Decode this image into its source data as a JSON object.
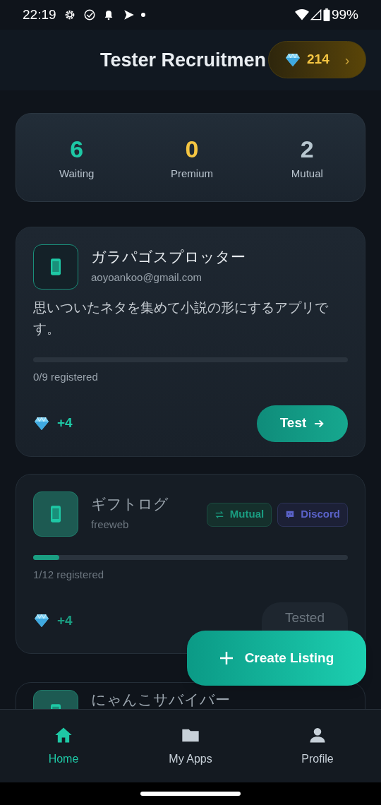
{
  "status_bar": {
    "time": "22:19",
    "battery": "99%"
  },
  "header": {
    "title": "Tester Recruitmen",
    "gems": "214",
    "chevron": "›"
  },
  "stats": [
    {
      "value": "6",
      "label": "Waiting",
      "color": "#1ec8a5"
    },
    {
      "value": "0",
      "label": "Premium",
      "color": "#f4c542"
    },
    {
      "value": "2",
      "label": "Mutual",
      "color": "#b8c7d0"
    }
  ],
  "listings": [
    {
      "name": "ガラパゴスプロッター",
      "developer": "aoyoankoo@gmail.com",
      "description": "思いついたネタを集めて小説の形にするアプリです。",
      "level": 0,
      "progress": "0/9 registered",
      "reward": "+4",
      "action": {
        "kind": "test",
        "label": "Test"
      }
    },
    {
      "name": "ギフトログ",
      "developer": "freeweb",
      "level": 0.083,
      "progress": "1/12 registered",
      "reward": "+4",
      "tags": [
        {
          "kind": "mutual",
          "label": "Mutual"
        },
        {
          "kind": "discord",
          "label": "Discord"
        }
      ],
      "action": {
        "kind": "tested",
        "label": "Tested"
      }
    },
    {
      "name": "にゃんこサバイバー"
    }
  ],
  "fab": {
    "label": "Create Listing"
  },
  "nav": [
    {
      "label": "Home",
      "selected": true
    },
    {
      "label": "My Apps",
      "selected": false
    },
    {
      "label": "Profile",
      "selected": false
    }
  ]
}
